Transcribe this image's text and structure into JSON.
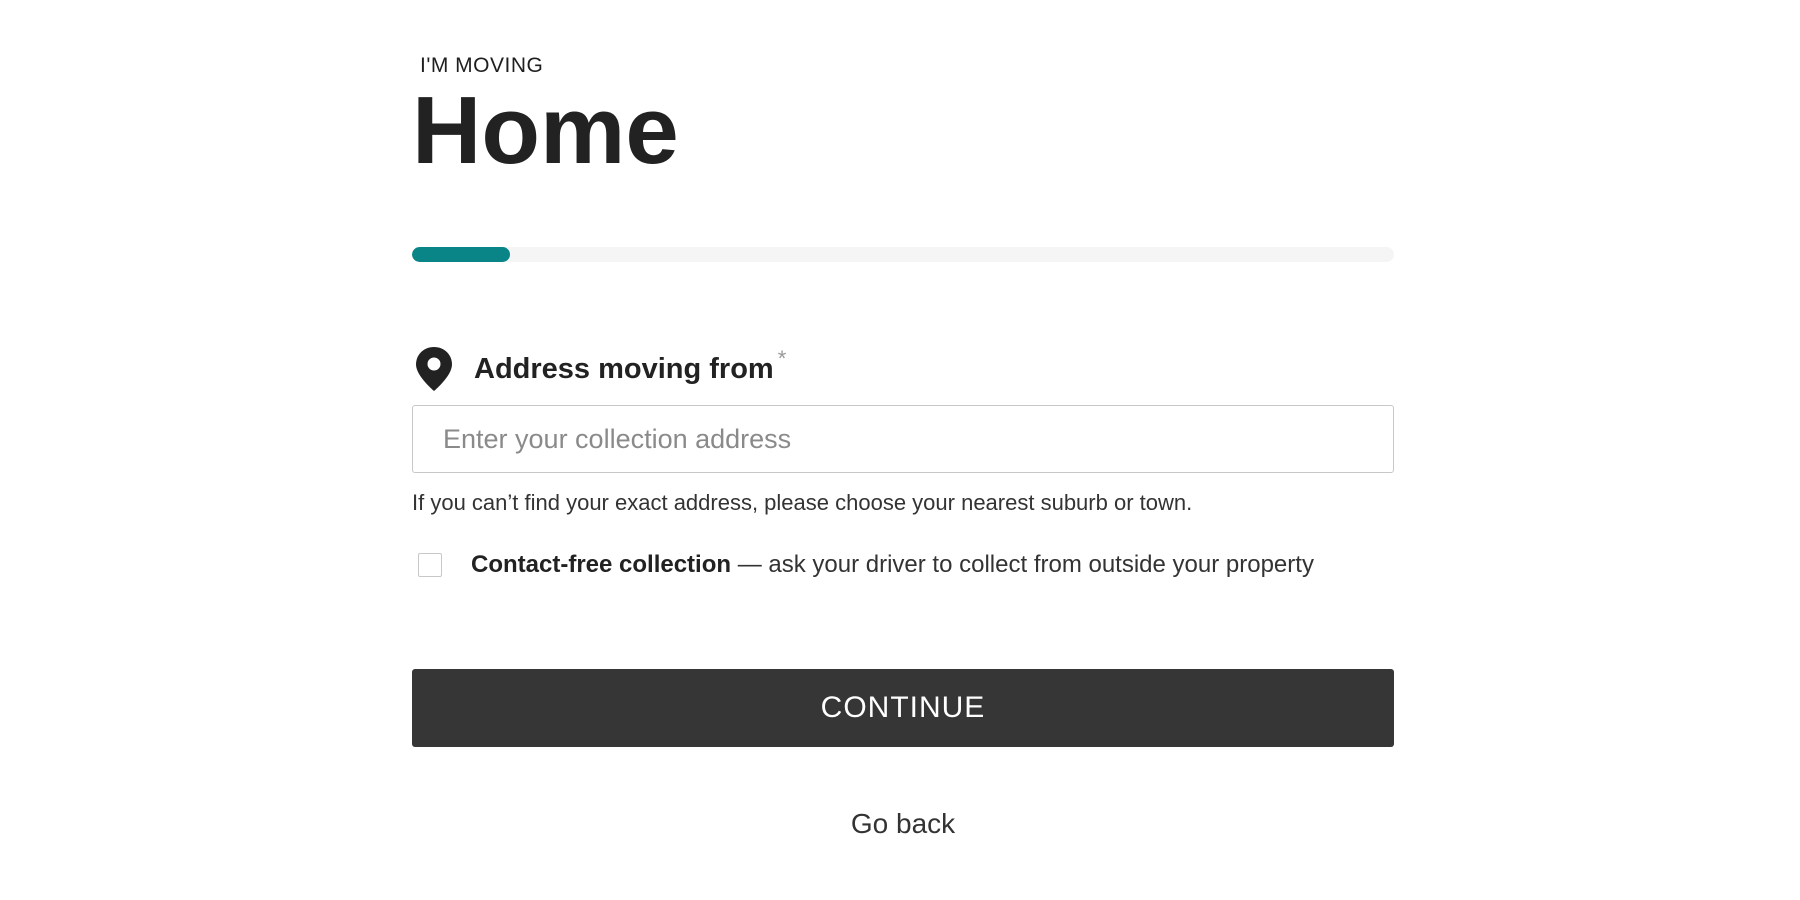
{
  "header": {
    "eyebrow": "I'M MOVING",
    "title": "Home"
  },
  "progress": {
    "fraction": 0.1,
    "accent_color": "#0a8587"
  },
  "address_field": {
    "icon": "location-pin-icon",
    "label": "Address moving from",
    "required_mark": "*",
    "placeholder": "Enter your collection address",
    "value": "",
    "helper_text": "If you can’t find your exact address, please choose your nearest suburb or town."
  },
  "contact_free": {
    "checked": false,
    "label_bold": "Contact-free collection",
    "label_rest": " — ask your driver to collect from outside your property"
  },
  "actions": {
    "continue_label": "CONTINUE",
    "back_label": "Go back"
  }
}
